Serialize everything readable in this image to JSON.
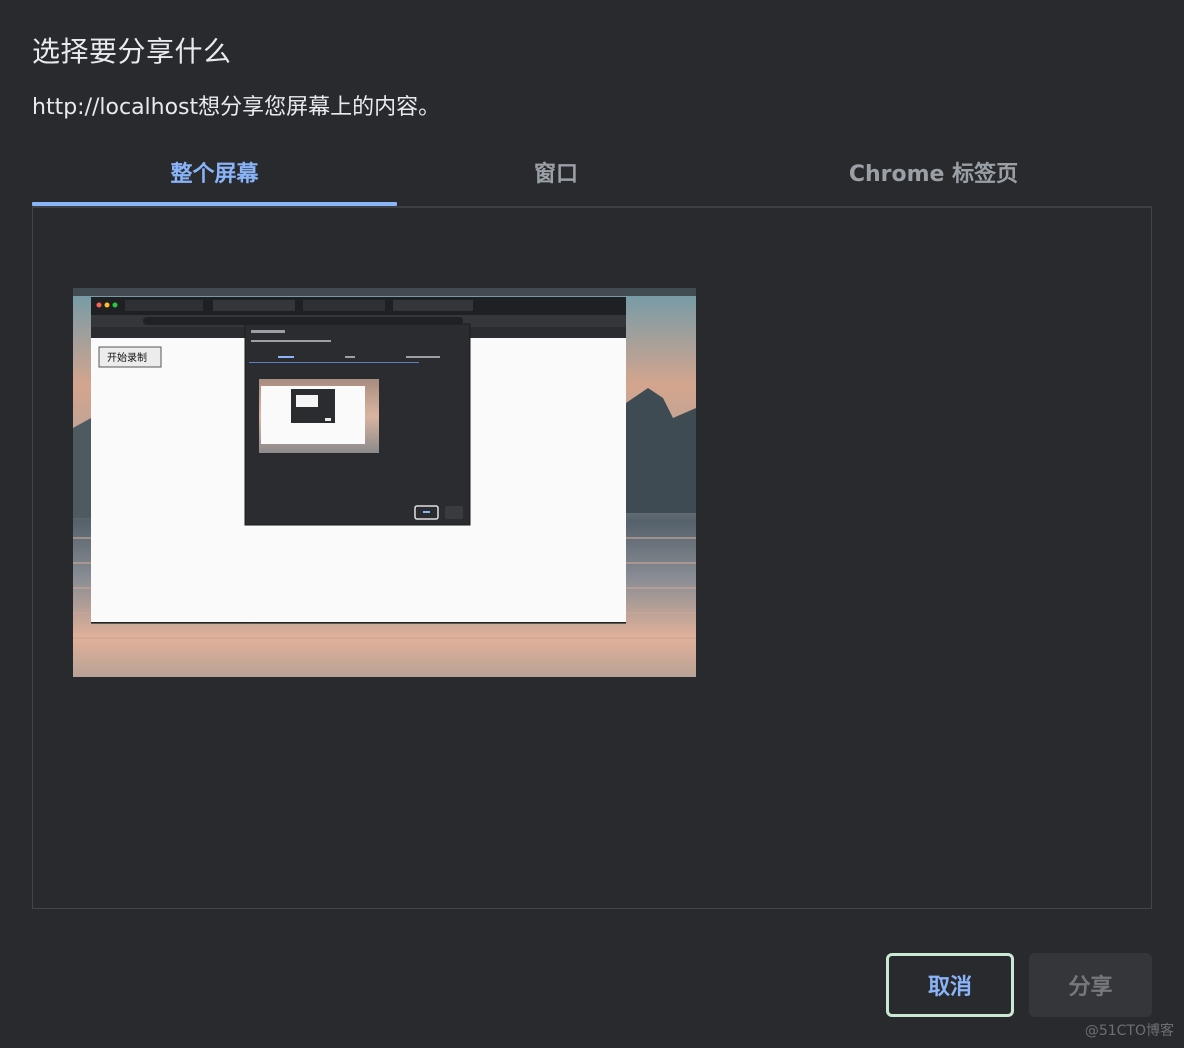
{
  "dialog": {
    "title": "选择要分享什么",
    "subtitle": "http://localhost想分享您屏幕上的内容。"
  },
  "tabs": [
    {
      "label": "整个屏幕",
      "active": true
    },
    {
      "label": "窗口",
      "active": false
    },
    {
      "label": "Chrome 标签页",
      "active": false
    }
  ],
  "thumbnail": {
    "page_button_label": "开始录制"
  },
  "buttons": {
    "cancel_label": "取消",
    "share_label": "分享",
    "share_enabled": false
  },
  "watermark": "@51CTO博客",
  "colors": {
    "background": "#292a2d",
    "accent": "#8ab4f8",
    "cancel_border": "#c9e9d5",
    "disabled_button": "#35363a"
  }
}
